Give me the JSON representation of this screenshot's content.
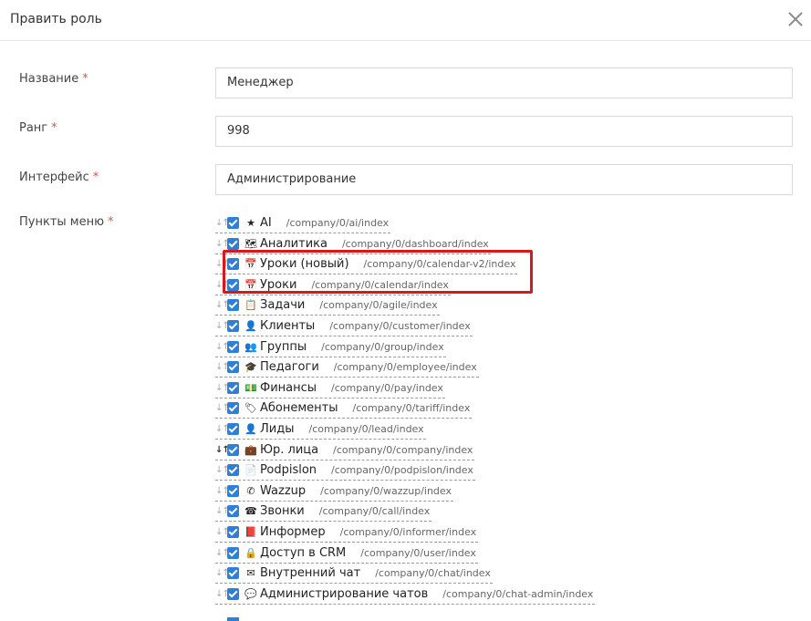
{
  "header": {
    "title": "Править роль"
  },
  "form": {
    "name": {
      "label": "Название",
      "value": "Менеджер"
    },
    "rank": {
      "label": "Ранг",
      "value": "998"
    },
    "interface": {
      "label": "Интерфейс",
      "value": "Администрирование"
    },
    "menu": {
      "label": "Пункты меню"
    },
    "required_mark": "*"
  },
  "menu_items": [
    {
      "icon": "star-icon",
      "glyph": "★",
      "label": "AI",
      "path": "/company/0/ai/index",
      "checked": true
    },
    {
      "icon": "map-icon",
      "glyph": "🗺",
      "label": "Аналитика",
      "path": "/company/0/dashboard/index",
      "checked": true
    },
    {
      "icon": "calendar-icon",
      "glyph": "📅",
      "label": "Уроки (новый)",
      "path": "/company/0/calendar-v2/index",
      "checked": true
    },
    {
      "icon": "calendar-icon",
      "glyph": "📅",
      "label": "Уроки",
      "path": "/company/0/calendar/index",
      "checked": true
    },
    {
      "icon": "clipboard-icon",
      "glyph": "📋",
      "label": "Задачи",
      "path": "/company/0/agile/index",
      "checked": true
    },
    {
      "icon": "user-icon",
      "glyph": "👤",
      "label": "Клиенты",
      "path": "/company/0/customer/index",
      "checked": true
    },
    {
      "icon": "users-icon",
      "glyph": "👥",
      "label": "Группы",
      "path": "/company/0/group/index",
      "checked": true
    },
    {
      "icon": "graduation-cap-icon",
      "glyph": "🎓",
      "label": "Педагоги",
      "path": "/company/0/employee/index",
      "checked": true
    },
    {
      "icon": "money-icon",
      "glyph": "💵",
      "label": "Финансы",
      "path": "/company/0/pay/index",
      "checked": true
    },
    {
      "icon": "tag-icon",
      "glyph": "🏷",
      "label": "Абонементы",
      "path": "/company/0/tariff/index",
      "checked": true
    },
    {
      "icon": "user-plus-icon",
      "glyph": "👤",
      "label": "Лиды",
      "path": "/company/0/lead/index",
      "checked": true
    },
    {
      "icon": "briefcase-icon",
      "glyph": "💼",
      "label": "Юр. лица",
      "path": "/company/0/company/index",
      "checked": true
    },
    {
      "icon": "file-icon",
      "glyph": "📄",
      "label": "Podpislon",
      "path": "/company/0/podpislon/index",
      "checked": true
    },
    {
      "icon": "whatsapp-icon",
      "glyph": "✆",
      "label": "Wazzup",
      "path": "/company/0/wazzup/index",
      "checked": true
    },
    {
      "icon": "phone-icon",
      "glyph": "☎",
      "label": "Звонки",
      "path": "/company/0/call/index",
      "checked": true
    },
    {
      "icon": "book-icon",
      "glyph": "📕",
      "label": "Информер",
      "path": "/company/0/informer/index",
      "checked": true
    },
    {
      "icon": "lock-icon",
      "glyph": "🔒",
      "label": "Доступ в CRM",
      "path": "/company/0/user/index",
      "checked": true
    },
    {
      "icon": "envelope-icon",
      "glyph": "✉",
      "label": "Внутренний чат",
      "path": "/company/0/chat/index",
      "checked": true
    },
    {
      "icon": "comments-icon",
      "glyph": "💬",
      "label": "Администрирование чатов",
      "path": "/company/0/chat-admin/index",
      "checked": true
    }
  ],
  "colors": {
    "accent": "#2f7ed8",
    "highlight": "#d6191b",
    "required": "#d9534f"
  }
}
